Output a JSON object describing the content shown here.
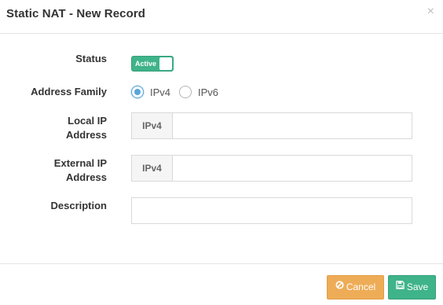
{
  "dialog": {
    "title": "Static NAT - New Record",
    "close_symbol": "×"
  },
  "form": {
    "status": {
      "label": "Status",
      "toggle_text": "Active",
      "enabled": true
    },
    "address_family": {
      "label": "Address Family",
      "options": [
        {
          "label": "IPv4",
          "selected": true
        },
        {
          "label": "IPv6",
          "selected": false
        }
      ]
    },
    "local_ip": {
      "label_line1": "Local IP",
      "label_line2": "Address",
      "addon": "IPv4",
      "value": ""
    },
    "external_ip": {
      "label_line1": "External IP",
      "label_line2": "Address",
      "addon": "IPv4",
      "value": ""
    },
    "description": {
      "label": "Description",
      "value": ""
    }
  },
  "footer": {
    "cancel_label": "Cancel",
    "cancel_icon": "ban-icon",
    "save_label": "Save",
    "save_icon": "floppy-disk-icon"
  },
  "colors": {
    "success": "#3fb38a",
    "warning": "#eeac57",
    "radio_accent": "#5aa6d8"
  }
}
